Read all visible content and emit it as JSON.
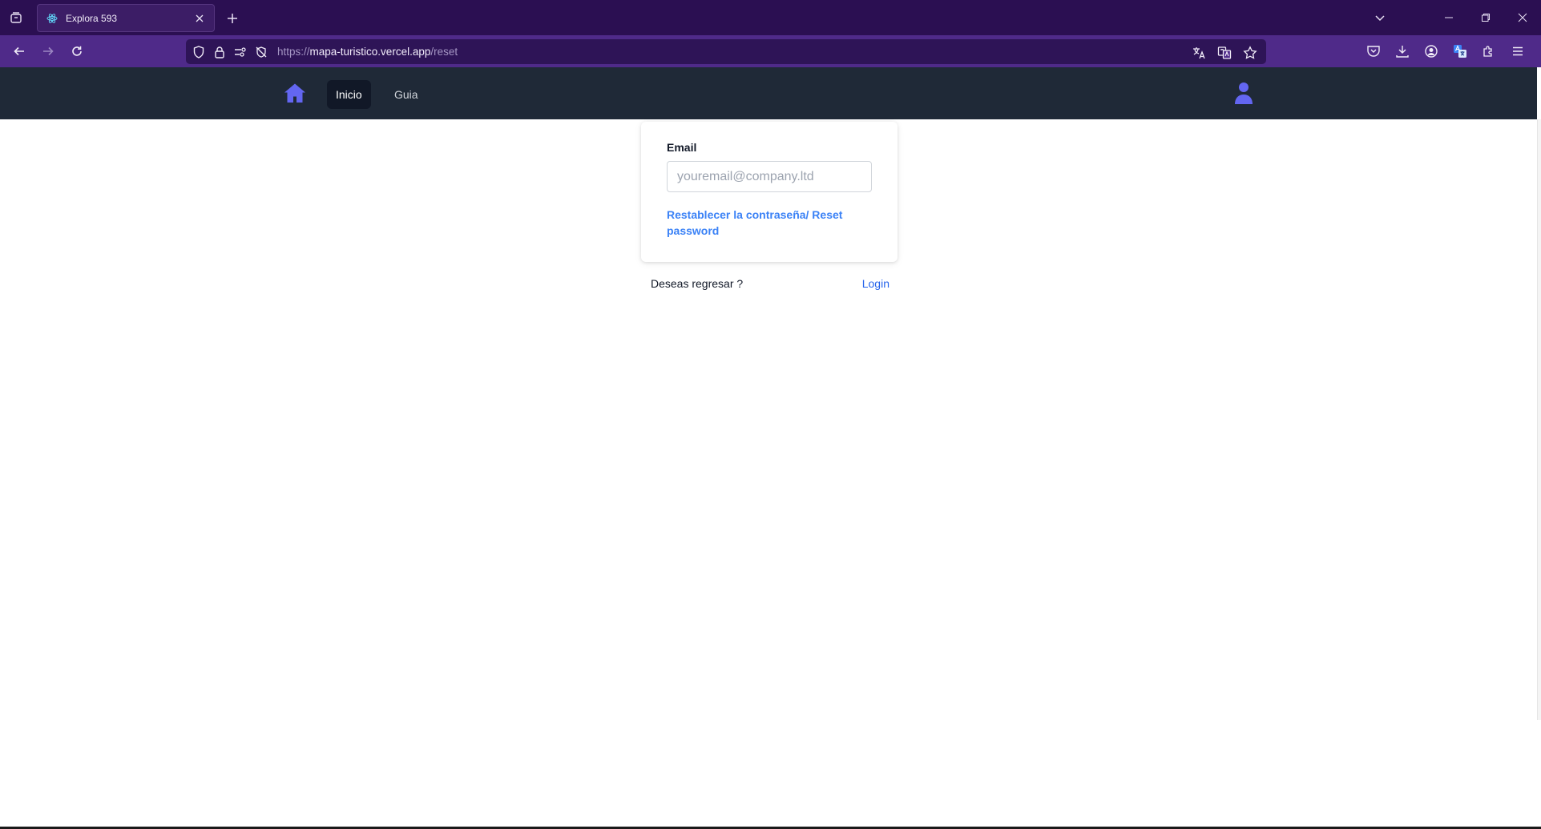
{
  "browser": {
    "tab_title": "Explora 593",
    "url_prefix": "https://",
    "url_host": "mapa-turistico.vercel.app",
    "url_path": "/reset",
    "accent": "#2b0f52"
  },
  "site": {
    "nav": {
      "home_label": "home",
      "items": [
        {
          "label": "Inicio",
          "active": true
        },
        {
          "label": "Guia",
          "active": false
        }
      ],
      "user_label": "user"
    },
    "reset_form": {
      "email_label": "Email",
      "email_placeholder": "youremail@company.ltd",
      "email_value": "",
      "submit_label": "Restablecer la contraseña/ Reset password"
    },
    "back_prompt": "Deseas regresar ?",
    "login_label": "Login",
    "colors": {
      "nav_bg": "#1f2937",
      "icon_accent": "#6366f1",
      "link_blue": "#3b82f6"
    }
  }
}
